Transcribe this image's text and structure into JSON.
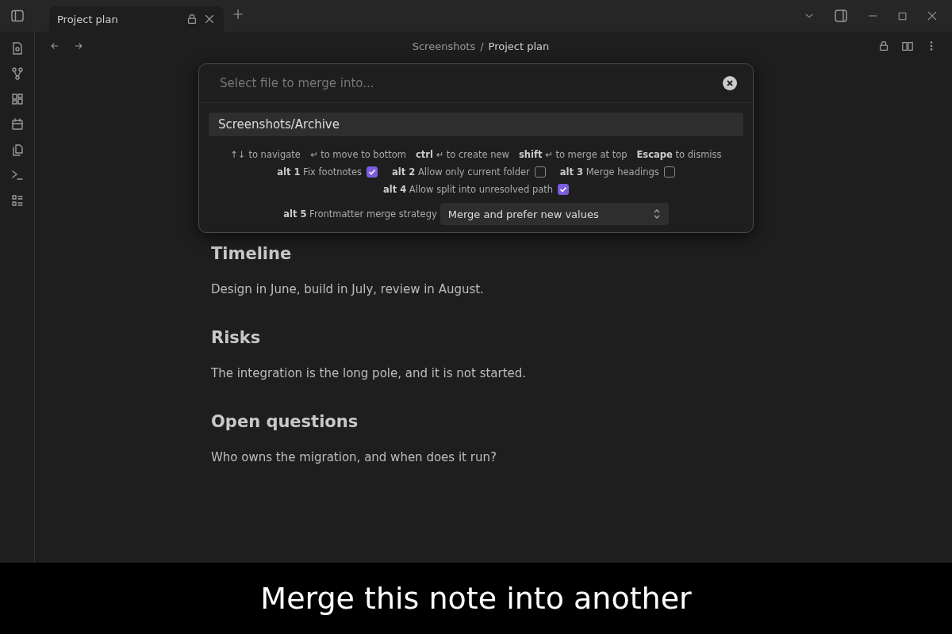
{
  "tabs": [
    {
      "label": "Project plan",
      "selected": true
    }
  ],
  "breadcrumb": {
    "folder": "Screenshots",
    "separator": "/",
    "file": "Project plan"
  },
  "note": {
    "sections": [
      {
        "heading": "Timeline",
        "text": "Design in June, build in July, review in August."
      },
      {
        "heading": "Risks",
        "text": "The integration is the long pole, and it is not started."
      },
      {
        "heading": "Open questions",
        "text": "Who owns the migration, and when does it run?"
      }
    ]
  },
  "merge_dialog": {
    "placeholder": "Select file to merge into...",
    "suggestions": [
      {
        "label": "Screenshots/Archive",
        "selected": true
      }
    ],
    "hints": [
      "↑↓ to navigate",
      "↵ to move to bottom",
      "**ctrl** ↵ to create new",
      "**shift** ↵ to merge at top",
      "**Escape** to dismiss"
    ],
    "option_rows": [
      [
        {
          "label": "**alt 1** Fix footnotes",
          "checked": true
        },
        {
          "label": "**alt 2** Allow only current folder",
          "checked": false
        },
        {
          "label": "**alt 3** Merge headings",
          "checked": false
        }
      ],
      [
        {
          "label": "**alt 4** Allow split into unresolved path",
          "checked": true
        }
      ]
    ],
    "strategy": {
      "label": "**alt 5** Frontmatter merge strategy",
      "value": "Merge and prefer new values"
    }
  },
  "caption": "Merge this note into another"
}
